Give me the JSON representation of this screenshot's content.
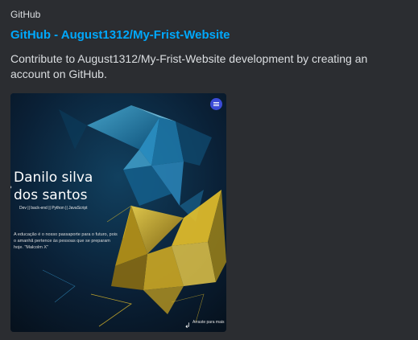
{
  "embed": {
    "provider": "GitHub",
    "title": "GitHub - August1312/My-Frist-Website",
    "description": "Contribute to August1312/My-Frist-Website development by creating an account on GitHub."
  },
  "thumbnail": {
    "name": "Danilo silva dos santos",
    "tags": "Dev || back-end || Python || JavaScript",
    "quote": "A educação é o nosso passaporte para o futuro, pois o amanhã pertence às pessoas que se preparam hoje. \"Malcolm X\"",
    "scroll_hint": "Arraste para mais",
    "menu_icon": "hamburger-icon"
  },
  "colors": {
    "background": "#2b2d31",
    "link": "#00a8fc",
    "text": "#dbdee1",
    "accent_blue": "#3aa7e0",
    "accent_yellow": "#e8c22a"
  }
}
